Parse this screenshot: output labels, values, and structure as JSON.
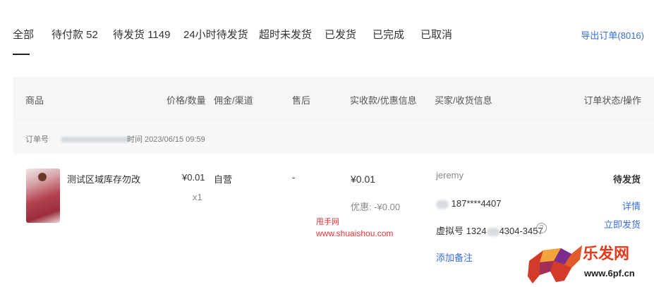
{
  "tabs": [
    {
      "label": "全部",
      "active": true
    },
    {
      "label": "待付款 52"
    },
    {
      "label": "待发货 1149"
    },
    {
      "label": "24小时待发货"
    },
    {
      "label": "超时未发货"
    },
    {
      "label": "已发货"
    },
    {
      "label": "已完成"
    },
    {
      "label": "已取消"
    }
  ],
  "export_label": "导出订单(8016)",
  "columns": [
    "商品",
    "价格/数量",
    "佣金/渠道",
    "售后",
    "实收款/优惠信息",
    "买家/收货信息",
    "订单状态/操作"
  ],
  "order": {
    "number_label": "订单号",
    "time_label": "时间 2023/06/15 09:59",
    "product_name": "测试区域库存勿改",
    "price": "¥0.01",
    "quantity": "x1",
    "channel": "自营",
    "after_sale": "-",
    "paid": "¥0.01",
    "discount": "优惠: -¥0.00",
    "buyer_name": "jeremy",
    "phone": "187****4407",
    "virtual_label": "虚拟号",
    "virtual_prefix": "1324",
    "virtual_suffix": "4304-3457",
    "add_note": "添加备注",
    "status": "待发货",
    "details_link": "详情",
    "ship_link": "立即发货"
  },
  "watermark": {
    "line1": "甩手网",
    "line2": "www.shuaishou.com",
    "logo_text": "乐发网",
    "logo_url": "www.6pf.cn"
  },
  "colors": {
    "accent": "#3a6fd8",
    "watermark_red": "#e53a1d"
  }
}
